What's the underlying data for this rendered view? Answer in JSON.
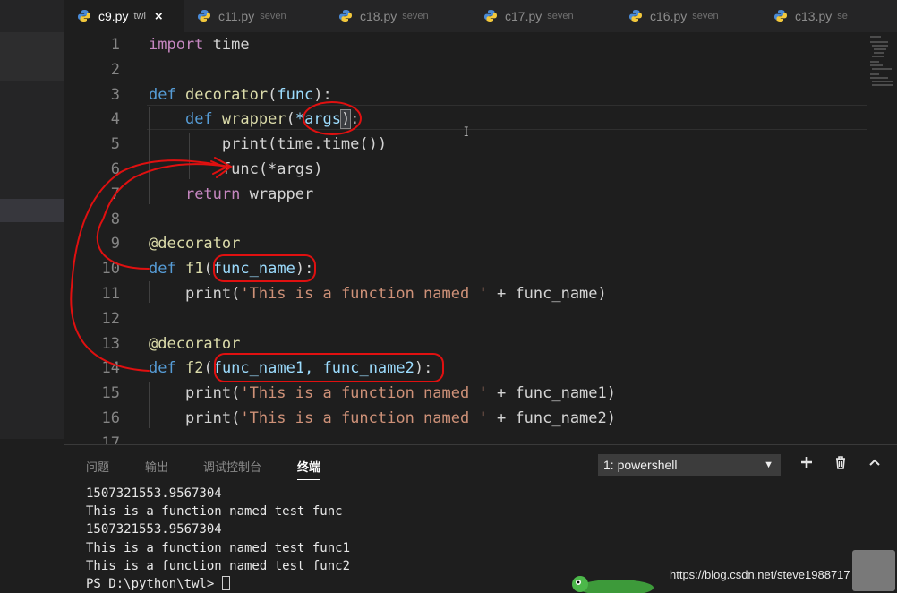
{
  "tabs": [
    {
      "name": "c9.py",
      "dir": "twl",
      "active": true
    },
    {
      "name": "c11.py",
      "dir": "seven",
      "active": false
    },
    {
      "name": "c18.py",
      "dir": "seven",
      "active": false
    },
    {
      "name": "c17.py",
      "dir": "seven",
      "active": false
    },
    {
      "name": "c16.py",
      "dir": "seven",
      "active": false
    },
    {
      "name": "c13.py",
      "dir": "se",
      "active": false
    }
  ],
  "tab_close_glyph": "×",
  "editor": {
    "lines": [
      {
        "n": "1",
        "tokens": [
          [
            "kw",
            "import"
          ],
          [
            "",
            " time"
          ]
        ]
      },
      {
        "n": "2",
        "tokens": []
      },
      {
        "n": "3",
        "tokens": [
          [
            "def",
            "def"
          ],
          [
            "",
            " "
          ],
          [
            "fn",
            "decorator"
          ],
          [
            "",
            "("
          ],
          [
            "param",
            "func"
          ],
          [
            "",
            "):"
          ]
        ]
      },
      {
        "n": "4",
        "tokens": [
          [
            "",
            "    "
          ],
          [
            "def",
            "def"
          ],
          [
            "",
            " "
          ],
          [
            "fn",
            "wrapper"
          ],
          [
            "",
            "("
          ],
          [
            "param",
            "*args"
          ],
          [
            "paren-hl",
            ")"
          ],
          [
            "",
            ":"
          ]
        ]
      },
      {
        "n": "5",
        "tokens": [
          [
            "",
            "        print(time.time())"
          ]
        ]
      },
      {
        "n": "6",
        "tokens": [
          [
            "",
            "        func(*args)"
          ]
        ]
      },
      {
        "n": "7",
        "tokens": [
          [
            "",
            "    "
          ],
          [
            "kw",
            "return"
          ],
          [
            "",
            " wrapper"
          ]
        ]
      },
      {
        "n": "8",
        "tokens": []
      },
      {
        "n": "9",
        "tokens": [
          [
            "deco",
            "@decorator"
          ]
        ]
      },
      {
        "n": "10",
        "tokens": [
          [
            "def",
            "def"
          ],
          [
            "",
            " "
          ],
          [
            "fn",
            "f1"
          ],
          [
            "",
            "("
          ],
          [
            "param",
            "func_name"
          ],
          [
            "",
            "):"
          ]
        ]
      },
      {
        "n": "11",
        "tokens": [
          [
            "",
            "    print("
          ],
          [
            "str",
            "'This is a function named '"
          ],
          [
            "",
            " + func_name)"
          ]
        ]
      },
      {
        "n": "12",
        "tokens": []
      },
      {
        "n": "13",
        "tokens": [
          [
            "deco",
            "@decorator"
          ]
        ]
      },
      {
        "n": "14",
        "tokens": [
          [
            "def",
            "def"
          ],
          [
            "",
            " "
          ],
          [
            "fn",
            "f2"
          ],
          [
            "",
            "("
          ],
          [
            "param",
            "func_name1, func_name2"
          ],
          [
            "",
            "):"
          ]
        ]
      },
      {
        "n": "15",
        "tokens": [
          [
            "",
            "    print("
          ],
          [
            "str",
            "'This is a function named '"
          ],
          [
            "",
            " + func_name1)"
          ]
        ]
      },
      {
        "n": "16",
        "tokens": [
          [
            "",
            "    print("
          ],
          [
            "str",
            "'This is a function named '"
          ],
          [
            "",
            " + func_name2)"
          ]
        ]
      },
      {
        "n": "17",
        "tokens": []
      }
    ]
  },
  "panel": {
    "tabs": [
      "问题",
      "输出",
      "调试控制台",
      "终端"
    ],
    "active_tab": "终端",
    "shell_select": "1: powershell",
    "icons": {
      "add": "plus-icon",
      "delete": "trash-icon",
      "collapse": "chevron-up-icon"
    },
    "terminal_lines": [
      "1507321553.9567304",
      "This is a function named test func",
      "1507321553.9567304",
      "This is a function named test func1",
      "This is a function named test func2",
      "PS D:\\python\\twl> "
    ]
  },
  "watermark": "https://blog.csdn.net/steve1988717",
  "colors": {
    "editor_bg": "#1e1e1e",
    "keyword": "#c586c0",
    "def": "#569cd6",
    "function": "#dcdcaa",
    "param": "#9cdcfe",
    "string": "#ce9178",
    "annotation": "#e01010"
  }
}
